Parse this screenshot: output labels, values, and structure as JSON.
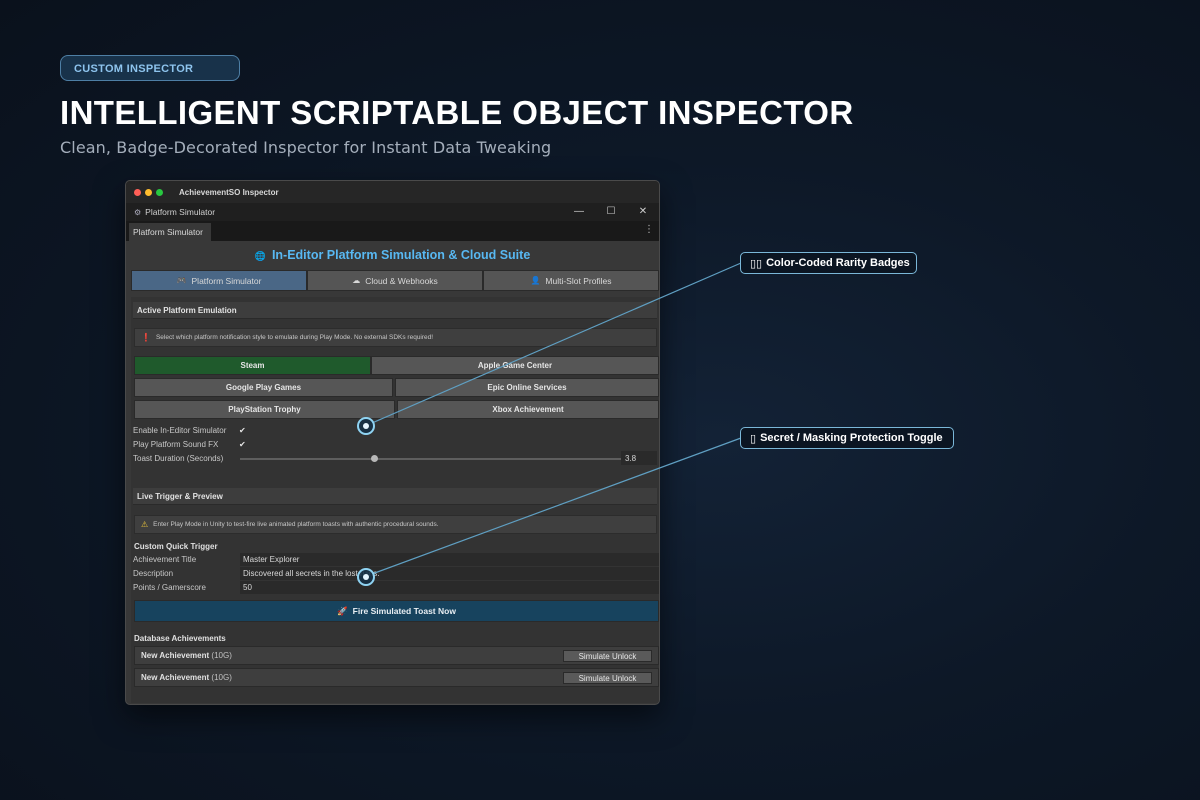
{
  "hero": {
    "tag": "CUSTOM INSPECTOR",
    "title": "INTELLIGENT SCRIPTABLE OBJECT INSPECTOR",
    "subtitle": "Clean, Badge-Decorated Inspector for Instant Data Tweaking"
  },
  "window": {
    "mac_title": "AchievementSO Inspector",
    "title": "Platform Simulator",
    "controls": [
      "—",
      "☐",
      "✕"
    ],
    "tab": "Platform Simulator",
    "menu_icon": "⋮"
  },
  "suite": {
    "title": "In-Editor Platform Simulation & Cloud Suite",
    "icon": "globe-icon",
    "icon_glyph": "🌐"
  },
  "tabs": [
    {
      "label": "Platform Simulator",
      "icon": "gamepad-icon",
      "glyph": "🎮",
      "selected": true
    },
    {
      "label": "Cloud & Webhooks",
      "icon": "cloud-icon",
      "glyph": "☁",
      "selected": false
    },
    {
      "label": "Multi-Slot Profiles",
      "icon": "user-icon",
      "glyph": "👤",
      "selected": false
    }
  ],
  "emulation": {
    "header": "Active Platform Emulation",
    "help": "Select which platform notification style to emulate during Play Mode. No external SDKs required!",
    "platforms": [
      "Steam",
      "Apple Game Center",
      "Google Play Games",
      "Epic Online Services",
      "PlayStation Trophy",
      "Xbox Achievement"
    ],
    "selected_platform": "Steam",
    "enable_label": "Enable In-Editor Simulator",
    "enable_checked": true,
    "sound_label": "Play Platform Sound FX",
    "sound_checked": true,
    "toast_label": "Toast Duration (Seconds)",
    "toast_value": "3.8",
    "toast_slider_fraction": 0.35
  },
  "live": {
    "header": "Live Trigger & Preview",
    "help": "Enter Play Mode in Unity to test-fire live animated platform toasts with authentic procedural sounds.",
    "quick_trigger": "Custom Quick Trigger",
    "title_label": "Achievement Title",
    "title_value": "Master Explorer",
    "desc_label": "Description",
    "desc_value": "Discovered all secrets in the lost ruins.",
    "points_label": "Points / Gamerscore",
    "points_value": "50",
    "fire_label": "Fire Simulated Toast Now",
    "fire_icon": "rocket-icon"
  },
  "database": {
    "header": "Database Achievements",
    "rows": [
      {
        "name": "New Achievement",
        "points": "(10G)",
        "button": "Simulate Unlock"
      },
      {
        "name": "New Achievement",
        "points": "(10G)",
        "button": "Simulate Unlock"
      }
    ]
  },
  "callouts": [
    {
      "label": "Color-Coded Rarity Badges",
      "icon": "badge-icon",
      "glyph": "▯▯"
    },
    {
      "label": "Secret / Masking Protection Toggle",
      "icon": "lock-icon",
      "glyph": "▯"
    }
  ],
  "colors": {
    "accent": "#58b8f2",
    "selected_tab": "#4a6786",
    "steam_selected": "#1f5a2c",
    "fire_button": "#17435e",
    "callout_border": "#7ab7d8"
  }
}
